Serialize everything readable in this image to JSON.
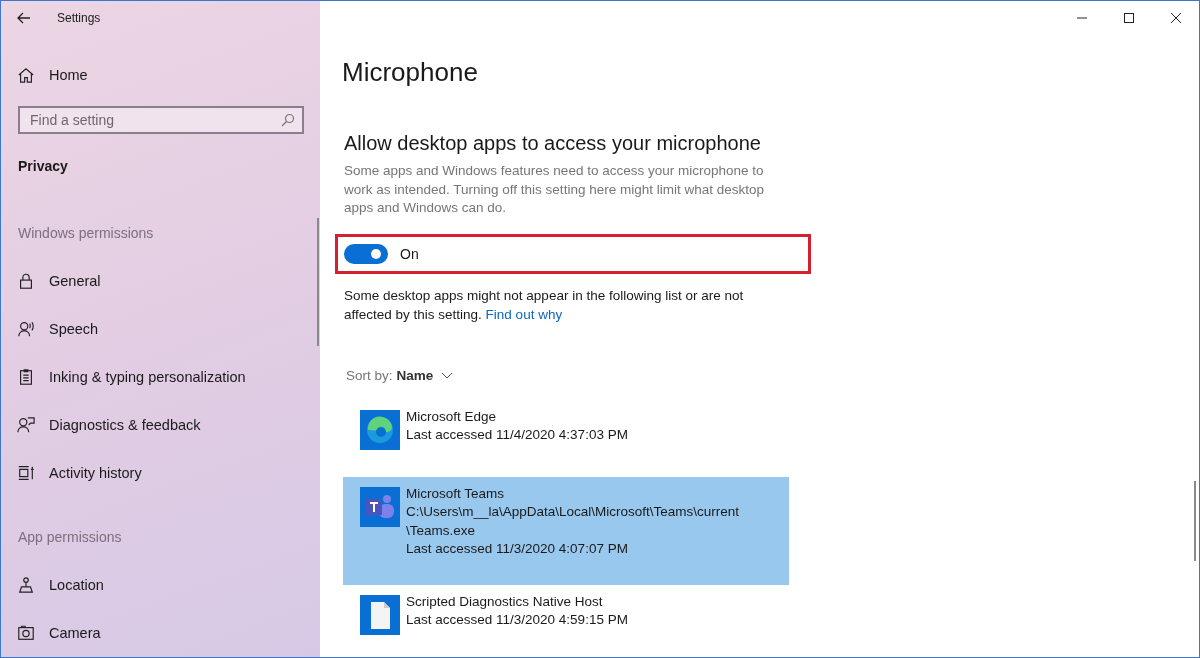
{
  "window": {
    "title": "Settings"
  },
  "sidebar": {
    "home": "Home",
    "search": {
      "placeholder": "Find a setting"
    },
    "category": "Privacy",
    "sections": [
      {
        "heading": "Windows permissions",
        "items": [
          {
            "label": "General"
          },
          {
            "label": "Speech"
          },
          {
            "label": "Inking & typing personalization"
          },
          {
            "label": "Diagnostics & feedback"
          },
          {
            "label": "Activity history"
          }
        ]
      },
      {
        "heading": "App permissions",
        "items": [
          {
            "label": "Location"
          },
          {
            "label": "Camera"
          }
        ]
      }
    ]
  },
  "page": {
    "title": "Microphone",
    "heading": "Allow desktop apps to access your microphone",
    "description": "Some apps and Windows features need to access your microphone to work as intended. Turning off this setting here might limit what desktop apps and Windows can do.",
    "toggle": {
      "on": true,
      "label": "On",
      "highlighted": true
    },
    "note": "Some desktop apps might not appear in the following list or are not affected by this setting.",
    "note_link": "Find out why",
    "sort": {
      "label": "Sort by:",
      "value": "Name"
    },
    "apps": [
      {
        "kind": "edge",
        "name": "Microsoft Edge",
        "accessed": "Last accessed 11/4/2020 4:37:03 PM",
        "selected": false
      },
      {
        "kind": "teams",
        "name": "Microsoft Teams",
        "path": "C:\\Users\\m__la\\AppData\\Local\\Microsoft\\Teams\\current\\Teams.exe",
        "accessed": "Last accessed 11/3/2020 4:07:07 PM",
        "selected": true
      },
      {
        "kind": "file",
        "name": "Scripted Diagnostics Native Host",
        "accessed": "Last accessed 11/3/2020 4:59:15 PM",
        "selected": false
      }
    ]
  }
}
